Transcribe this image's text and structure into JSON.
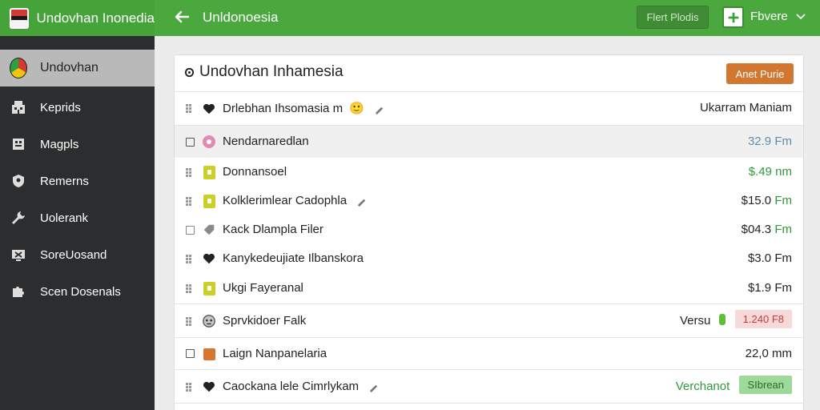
{
  "app": {
    "title": "Undovhan Inonedia",
    "page_title": "Unldonoesia",
    "top_button": "Flert Plodis",
    "dropdown_label": "Fbvere"
  },
  "sidebar": {
    "items": [
      {
        "label": "Undovhan",
        "icon": "flag-ball-icon",
        "active": true
      },
      {
        "label": "Keprids",
        "icon": "building-icon"
      },
      {
        "label": "Magpls",
        "icon": "map-icon"
      },
      {
        "label": "Remerns",
        "icon": "shield-icon"
      },
      {
        "label": "Uolerank",
        "icon": "wrench-icon"
      },
      {
        "label": "SoreUosand",
        "icon": "screen-icon"
      },
      {
        "label": "Scen Dosenals",
        "icon": "puzzle-icon"
      }
    ]
  },
  "panel": {
    "title": "Undovhan Inhamesia",
    "button": "Anet Purie",
    "rows": [
      {
        "label": "Drlebhan Ihsomasia m",
        "emoji": "🙂",
        "value": "Ukarram Maniam"
      },
      {
        "label": "Nendarnaredlan",
        "value": "32.9",
        "unit": "Fm"
      },
      {
        "label": "Donnansoel",
        "value": "$.49",
        "unit": "nm"
      },
      {
        "label": "Kolklerimlear Cadophla",
        "value": "$15.0",
        "unit": "Fm"
      },
      {
        "label": "Kack Dlampla Filer",
        "value": "$04.3",
        "unit": "Fm"
      },
      {
        "label": "Kanykedeujiate Ilbanskora",
        "value": "$3.0",
        "unit": "Fm"
      },
      {
        "label": "Ukgi Fayeranal",
        "value": "$1.9",
        "unit": "Fm"
      },
      {
        "label": "Sprvkidoer Falk",
        "prefix": "Versu",
        "chip": "1.240 F8"
      },
      {
        "label": "Laign Nanpanelaria",
        "value": "22,0",
        "unit": "mm"
      },
      {
        "label": "Caockana lele Cimrlykam",
        "prefix": "Verchanot",
        "chip": "SIbrean"
      }
    ]
  },
  "colors": {
    "accent_green": "#4aa83e",
    "sidebar_bg": "#2b2d2e",
    "orange_button": "#d2772f"
  }
}
